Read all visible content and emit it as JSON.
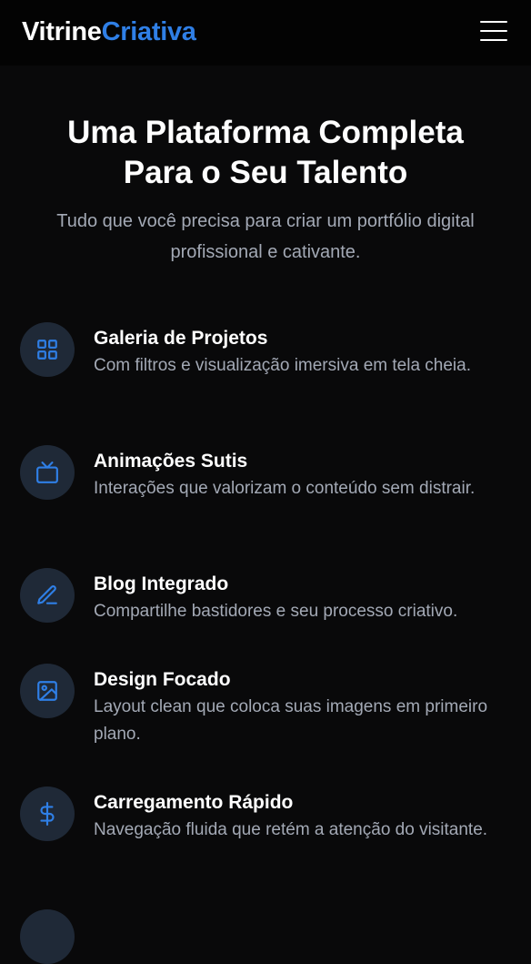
{
  "header": {
    "logo_part1": "Vitrine",
    "logo_part2": "Criativa",
    "menu_icon": "hamburger-menu-icon"
  },
  "hero": {
    "title": "Uma Plataforma Completa Para o Seu Talento",
    "subtitle": "Tudo que você precisa para criar um portfólio digital profissional e cativante."
  },
  "accent_color": "#2f7fe6",
  "features": [
    {
      "icon": "grid-icon",
      "title": "Galeria de Projetos",
      "description": "Com filtros e visualização imersiva em tela cheia."
    },
    {
      "icon": "tv-icon",
      "title": "Animações Sutis",
      "description": "Interações que valorizam o conteúdo sem distrair."
    },
    {
      "icon": "pen-icon",
      "title": "Blog Integrado",
      "description": "Compartilhe bastidores e seu processo criativo."
    },
    {
      "icon": "image-icon",
      "title": "Design Focado",
      "description": "Layout clean que coloca suas imagens em primeiro plano."
    },
    {
      "icon": "dollar-icon",
      "title": "Carregamento Rápido",
      "description": "Navegação fluida que retém a atenção do visitante."
    }
  ]
}
